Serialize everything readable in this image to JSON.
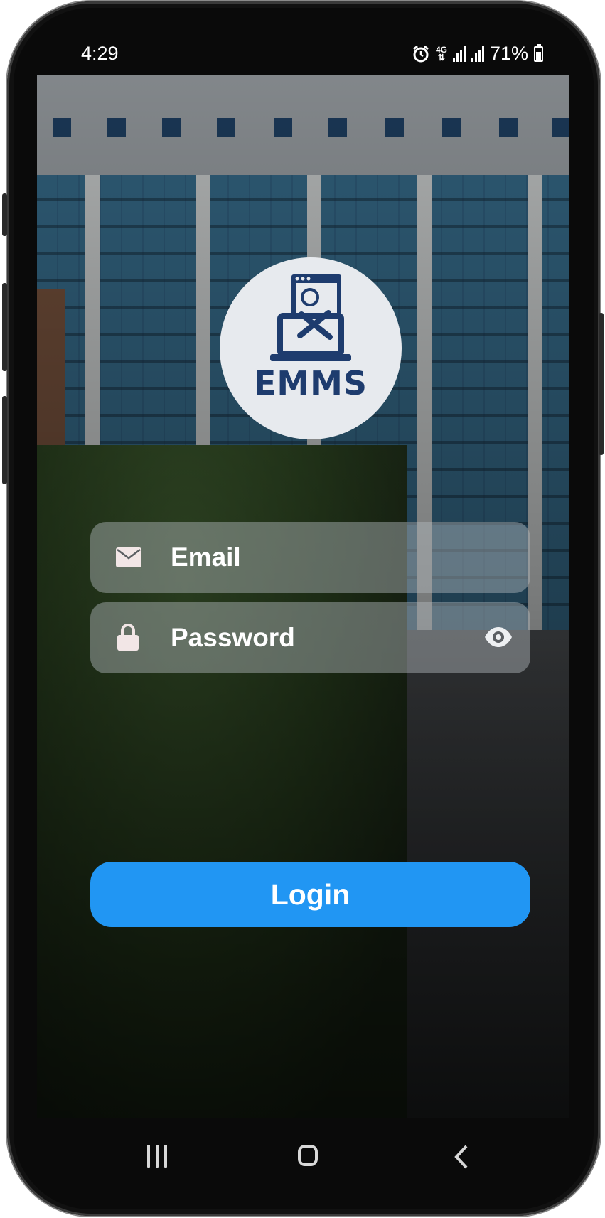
{
  "status_bar": {
    "time": "4:29",
    "network": "4G",
    "battery_percent": "71%",
    "icons": [
      "alarm-icon",
      "network-4g-icon",
      "signal-icon",
      "signal-icon",
      "battery-icon"
    ]
  },
  "logo": {
    "text": "EMMS"
  },
  "form": {
    "email_placeholder": "Email",
    "password_placeholder": "Password",
    "login_label": "Login"
  },
  "nav_bar": {
    "items": [
      "recents-button",
      "home-button",
      "back-button"
    ]
  },
  "colors": {
    "primary_button": "#2196f3",
    "logo_text": "#1e3c6e",
    "logo_background": "#e7eaee",
    "field_icon": "#f2e6e6"
  }
}
